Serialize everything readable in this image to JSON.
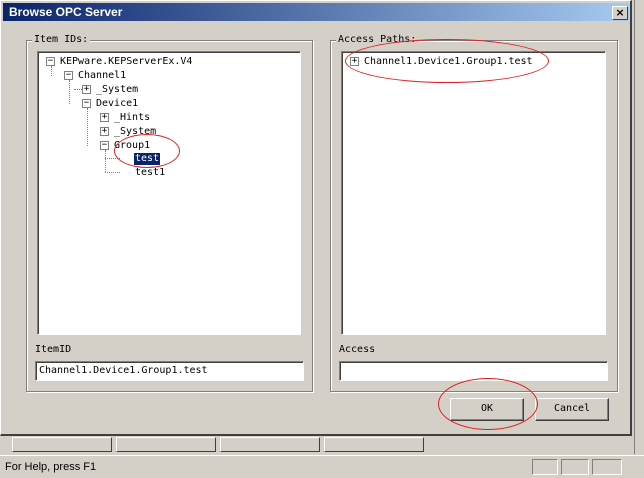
{
  "dialog": {
    "title": "Browse OPC Server",
    "close_glyph": "×"
  },
  "item_ids": {
    "legend": "Item IDs:",
    "tree": [
      {
        "label": "KEPware.KEPServerEx.V4",
        "expander": "−"
      },
      {
        "label": "Channel1",
        "expander": "−"
      },
      {
        "label": "_System",
        "expander": "+"
      },
      {
        "label": "Device1",
        "expander": "−"
      },
      {
        "label": "_Hints",
        "expander": "+"
      },
      {
        "label": "_System",
        "expander": "+"
      },
      {
        "label": "Group1",
        "expander": "−"
      },
      {
        "label": "test",
        "selected": true
      },
      {
        "label": "test1"
      }
    ],
    "field_label": "ItemID",
    "field_value": "Channel1.Device1.Group1.test"
  },
  "access_paths": {
    "legend": "Access Paths:",
    "tree": [
      {
        "label": "Channel1.Device1.Group1.test",
        "expander": "+"
      }
    ],
    "field_label": "Access",
    "field_value": ""
  },
  "buttons": {
    "ok": "OK",
    "cancel": "Cancel"
  },
  "status_bar": {
    "text": "For Help, press F1"
  },
  "colors": {
    "title_bar_start": "#0a246a",
    "title_bar_end": "#a6caf0",
    "annotation_ring": "#dd2222",
    "selection": "#0a246a"
  }
}
